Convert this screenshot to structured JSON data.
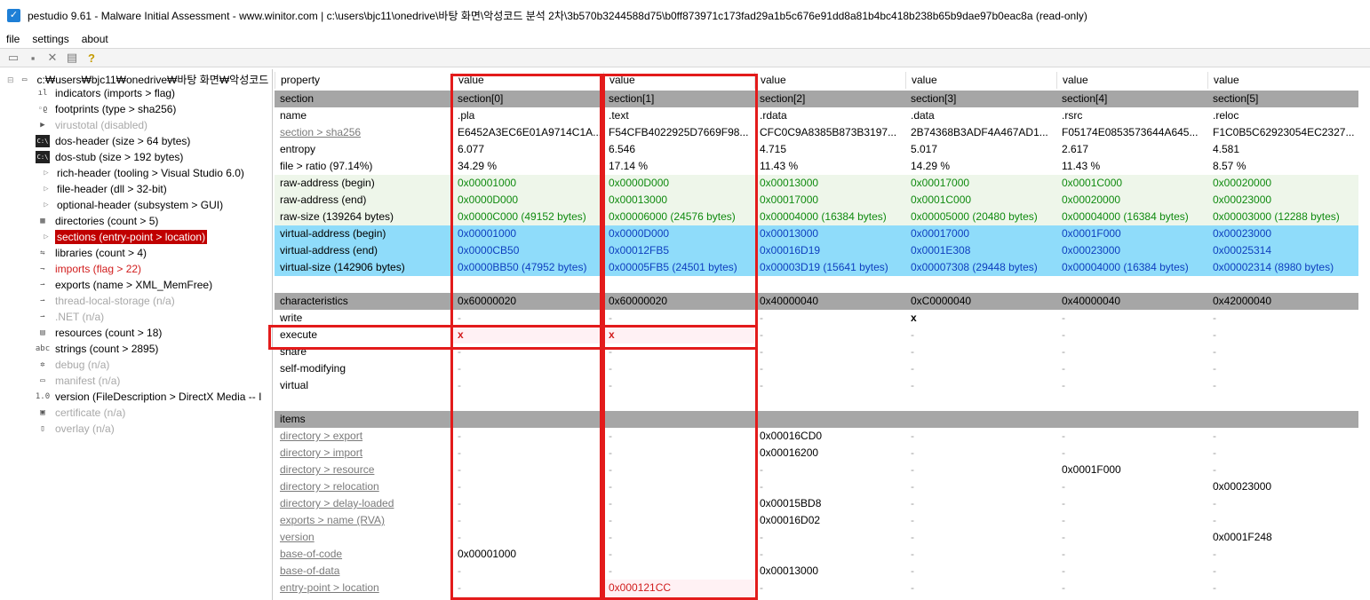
{
  "window": {
    "title": "pestudio 9.61 - Malware Initial Assessment - www.winitor.com | c:\\users\\bjc11\\onedrive\\바탕 화면\\악성코드 분석 2차\\3b570b3244588d75\\b0ff873971c173fad29a1b5c676e91dd8a81b4bc418b238b65b9dae97b0eac8a (read-only)"
  },
  "menu": [
    "file",
    "settings",
    "about"
  ],
  "tree": {
    "root": "c:₩users₩bjc11₩onedrive₩바탕 화면₩악성코드",
    "items": [
      {
        "label": "indicators (imports > flag)",
        "style": "normal",
        "icon": "bars-icon"
      },
      {
        "label": "footprints (type > sha256)",
        "style": "normal",
        "icon": "footprints-icon"
      },
      {
        "label": "virustotal (disabled)",
        "style": "gray",
        "icon": "virustotal-icon"
      },
      {
        "label": "dos-header (size > 64 bytes)",
        "style": "normal",
        "icon": "dos-icon"
      },
      {
        "label": "dos-stub (size > 192 bytes)",
        "style": "normal",
        "icon": "dos-icon"
      },
      {
        "label": "rich-header (tooling > Visual Studio 6.0)",
        "style": "normal",
        "icon": "expand-icon"
      },
      {
        "label": "file-header (dll > 32-bit)",
        "style": "normal",
        "icon": "expand-icon"
      },
      {
        "label": "optional-header (subsystem > GUI)",
        "style": "normal",
        "icon": "expand-icon"
      },
      {
        "label": "directories (count > 5)",
        "style": "normal",
        "icon": "directories-icon"
      },
      {
        "label": "sections (entry-point > location)",
        "style": "selected",
        "icon": "expand-icon"
      },
      {
        "label": "libraries (count > 4)",
        "style": "normal",
        "icon": "libraries-icon"
      },
      {
        "label": "imports (flag > 22)",
        "style": "red",
        "icon": "imports-icon"
      },
      {
        "label": "exports (name > XML_MemFree)",
        "style": "normal",
        "icon": "exports-icon"
      },
      {
        "label": "thread-local-storage (n/a)",
        "style": "gray",
        "icon": "tls-icon"
      },
      {
        "label": ".NET (n/a)",
        "style": "gray",
        "icon": "dotnet-icon"
      },
      {
        "label": "resources (count > 18)",
        "style": "normal",
        "icon": "resources-icon"
      },
      {
        "label": "strings (count > 2895)",
        "style": "normal",
        "icon": "strings-icon"
      },
      {
        "label": "debug (n/a)",
        "style": "gray",
        "icon": "debug-icon"
      },
      {
        "label": "manifest (n/a)",
        "style": "gray",
        "icon": "manifest-icon"
      },
      {
        "label": "version (FileDescription > DirectX Media -- I",
        "style": "normal",
        "icon": "version-icon"
      },
      {
        "label": "certificate (n/a)",
        "style": "gray",
        "icon": "certificate-icon"
      },
      {
        "label": "overlay (n/a)",
        "style": "gray",
        "icon": "overlay-icon"
      }
    ]
  },
  "grid": {
    "header": [
      "property",
      "value",
      "value",
      "value",
      "value",
      "value",
      "value"
    ],
    "rows": [
      {
        "bg": "grey",
        "cells": [
          "section",
          "section[0]",
          "section[1]",
          "section[2]",
          "section[3]",
          "section[4]",
          "section[5]"
        ]
      },
      {
        "bg": "none",
        "cells": [
          "name",
          ".pla",
          ".text",
          ".rdata",
          ".data",
          ".rsrc",
          ".reloc"
        ]
      },
      {
        "bg": "none",
        "cells": [
          "section > sha256",
          "E6452A3EC6E01A9714C1A...",
          "F54CFB4022925D7669F98...",
          "CFC0C9A8385B873B3197...",
          "2B74368B3ADF4A467AD1...",
          "F05174E0853573644A645...",
          "F1C0B5C62923054EC2327..."
        ],
        "labelStyle": "link"
      },
      {
        "bg": "none",
        "cells": [
          "entropy",
          "6.077",
          "6.546",
          "4.715",
          "5.017",
          "2.617",
          "4.581"
        ]
      },
      {
        "bg": "none",
        "cells": [
          "file > ratio (97.14%)",
          "34.29 %",
          "17.14 %",
          "11.43 %",
          "14.29 %",
          "11.43 %",
          "8.57 %"
        ]
      },
      {
        "bg": "green",
        "color": "green",
        "cells": [
          "raw-address (begin)",
          "0x00001000",
          "0x0000D000",
          "0x00013000",
          "0x00017000",
          "0x0001C000",
          "0x00020000"
        ]
      },
      {
        "bg": "green",
        "color": "green",
        "cells": [
          "raw-address (end)",
          "0x0000D000",
          "0x00013000",
          "0x00017000",
          "0x0001C000",
          "0x00020000",
          "0x00023000"
        ]
      },
      {
        "bg": "green",
        "color": "green",
        "cells": [
          "raw-size (139264 bytes)",
          "0x0000C000 (49152 bytes)",
          "0x00006000 (24576 bytes)",
          "0x00004000 (16384 bytes)",
          "0x00005000 (20480 bytes)",
          "0x00004000 (16384 bytes)",
          "0x00003000 (12288 bytes)"
        ]
      },
      {
        "bg": "blue",
        "color": "blue",
        "cells": [
          "virtual-address (begin)",
          "0x00001000",
          "0x0000D000",
          "0x00013000",
          "0x00017000",
          "0x0001F000",
          "0x00023000"
        ]
      },
      {
        "bg": "blue",
        "color": "blue",
        "cells": [
          "virtual-address (end)",
          "0x0000CB50",
          "0x00012FB5",
          "0x00016D19",
          "0x0001E308",
          "0x00023000",
          "0x00025314"
        ]
      },
      {
        "bg": "blue",
        "color": "blue",
        "cells": [
          "virtual-size (142906 bytes)",
          "0x0000BB50 (47952 bytes)",
          "0x00005FB5 (24501 bytes)",
          "0x00003D19 (15641 bytes)",
          "0x00007308 (29448 bytes)",
          "0x00004000 (16384 bytes)",
          "0x00002314 (8980 bytes)"
        ]
      },
      {
        "bg": "none",
        "cells": [
          "",
          "",
          "",
          "",
          "",
          "",
          ""
        ]
      },
      {
        "bg": "grey",
        "cells": [
          "characteristics",
          "0x60000020",
          "0x60000020",
          "0x40000040",
          "0xC0000040",
          "0x40000040",
          "0x42000040"
        ]
      },
      {
        "bg": "none",
        "cells": [
          "write",
          "-",
          "-",
          "-",
          "x",
          "-",
          "-"
        ]
      },
      {
        "bg": "pink",
        "cells": [
          "execute",
          "x",
          "x",
          "-",
          "-",
          "-",
          "-"
        ]
      },
      {
        "bg": "none",
        "cells": [
          "share",
          "-",
          "-",
          "-",
          "-",
          "-",
          "-"
        ]
      },
      {
        "bg": "none",
        "cells": [
          "self-modifying",
          "-",
          "-",
          "-",
          "-",
          "-",
          "-"
        ]
      },
      {
        "bg": "none",
        "cells": [
          "virtual",
          "-",
          "-",
          "-",
          "-",
          "-",
          "-"
        ]
      },
      {
        "bg": "none",
        "cells": [
          "",
          "",
          "",
          "",
          "",
          "",
          ""
        ]
      },
      {
        "bg": "grey",
        "cells": [
          "items",
          "",
          "",
          "",
          "",
          "",
          ""
        ]
      },
      {
        "bg": "none",
        "labelStyle": "link",
        "cells": [
          "directory > export",
          "-",
          "-",
          "0x00016CD0",
          "-",
          "-",
          "-"
        ]
      },
      {
        "bg": "none",
        "labelStyle": "link",
        "cells": [
          "directory > import",
          "-",
          "-",
          "0x00016200",
          "-",
          "-",
          "-"
        ]
      },
      {
        "bg": "none",
        "labelStyle": "link",
        "cells": [
          "directory > resource",
          "-",
          "-",
          "-",
          "-",
          "0x0001F000",
          "-"
        ]
      },
      {
        "bg": "none",
        "labelStyle": "link",
        "cells": [
          "directory > relocation",
          "-",
          "-",
          "-",
          "-",
          "-",
          "0x00023000"
        ]
      },
      {
        "bg": "none",
        "labelStyle": "link",
        "cells": [
          "directory > delay-loaded",
          "-",
          "-",
          "0x00015BD8",
          "-",
          "-",
          "-"
        ]
      },
      {
        "bg": "none",
        "labelStyle": "link",
        "cells": [
          "exports > name (RVA)",
          "-",
          "-",
          "0x00016D02",
          "-",
          "-",
          "-"
        ]
      },
      {
        "bg": "none",
        "labelStyle": "link",
        "cells": [
          "version",
          "-",
          "-",
          "-",
          "-",
          "-",
          "0x0001F248"
        ]
      },
      {
        "bg": "none",
        "labelStyle": "link",
        "cells": [
          "base-of-code",
          "0x00001000",
          "-",
          "-",
          "-",
          "-",
          "-"
        ]
      },
      {
        "bg": "none",
        "labelStyle": "link",
        "cells": [
          "base-of-data",
          "-",
          "-",
          "0x00013000",
          "-",
          "-",
          "-"
        ]
      },
      {
        "bg": "none",
        "labelStyle": "link",
        "cells": [
          "entry-point > location",
          "-",
          "0x000121CC",
          "-",
          "-",
          "-",
          "-"
        ]
      }
    ]
  },
  "colors": {
    "accent_red": "#e31b1b",
    "selected_bg": "#c00000",
    "green_text": "#0f8a0f",
    "blue_text": "#0e3fbf",
    "blue_bg": "#8fdcfa"
  }
}
